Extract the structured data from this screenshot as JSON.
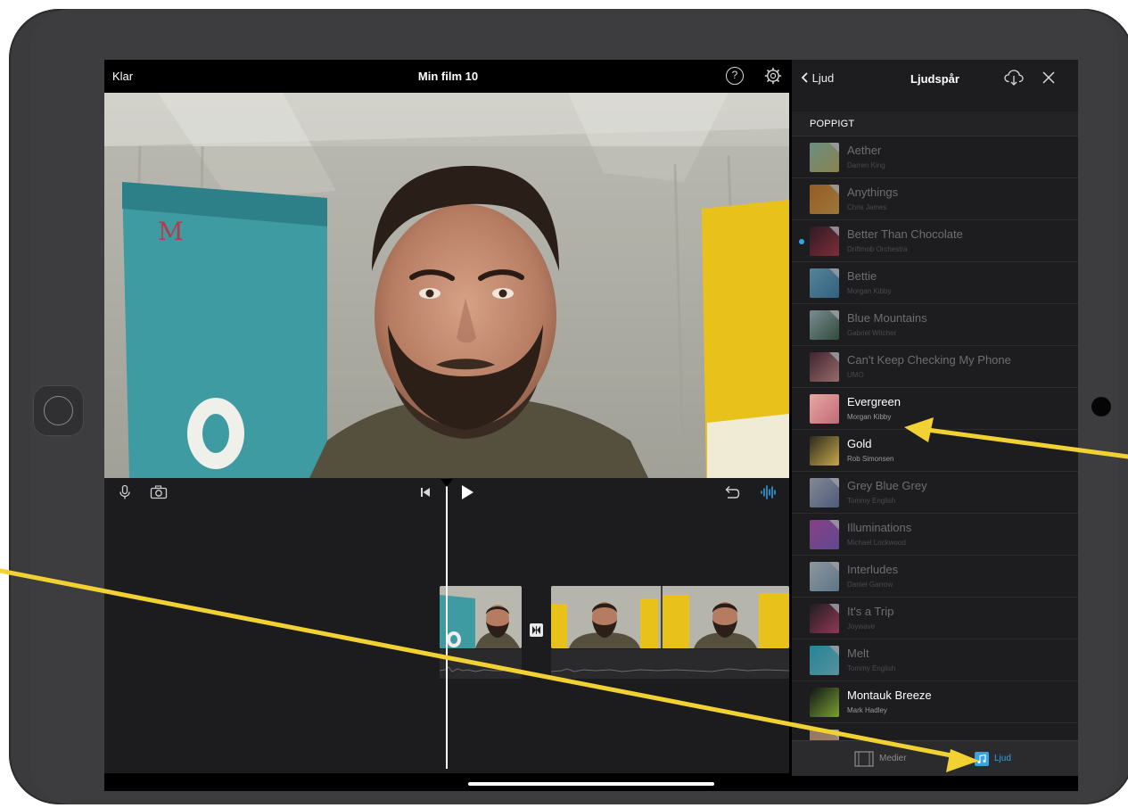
{
  "topbar": {
    "done_label": "Klar",
    "title": "Min film 10",
    "help_glyph": "?"
  },
  "panel": {
    "back_label": "Ljud",
    "title": "Ljudspår",
    "section": "POPPIGT",
    "tracks": [
      {
        "name": "Aether",
        "artist": "Darren King",
        "available": false,
        "art": [
          "#9fd8c8",
          "#d3c86a"
        ]
      },
      {
        "name": "Anythings",
        "artist": "Chris James",
        "available": false,
        "art": [
          "#e8862a",
          "#f2b34a"
        ]
      },
      {
        "name": "Better Than Chocolate",
        "artist": "Driftmob Orchestra",
        "available": false,
        "art": [
          "#3a1a2a",
          "#c0394a"
        ]
      },
      {
        "name": "Bettie",
        "artist": "Morgan Kibby",
        "available": false,
        "art": [
          "#7ac8e8",
          "#3f8fc0"
        ]
      },
      {
        "name": "Blue Mountains",
        "artist": "Gabriel Witcher",
        "available": false,
        "art": [
          "#b8d6e0",
          "#3e6a4e"
        ]
      },
      {
        "name": "Can't Keep Checking My Phone",
        "artist": "UMO",
        "available": false,
        "art": [
          "#5a2a3a",
          "#e8a0a0"
        ]
      },
      {
        "name": "Evergreen",
        "artist": "Morgan Kibby",
        "available": true,
        "art": [
          "#e8a8a0",
          "#c06a78"
        ]
      },
      {
        "name": "Gold",
        "artist": "Rob Simonsen",
        "available": true,
        "art": [
          "#2a2a1e",
          "#c8a84a"
        ]
      },
      {
        "name": "Grey Blue Grey",
        "artist": "Tommy English",
        "available": false,
        "art": [
          "#c8d0e0",
          "#6e86b8"
        ]
      },
      {
        "name": "Illuminations",
        "artist": "Michael Lockwood",
        "available": false,
        "art": [
          "#d058c8",
          "#8a68e0"
        ]
      },
      {
        "name": "Interludes",
        "artist": "Daniel Garrow",
        "available": false,
        "art": [
          "#d8e8f0",
          "#8ab0d0"
        ]
      },
      {
        "name": "It's a Trip",
        "artist": "Joywave",
        "available": false,
        "art": [
          "#202020",
          "#e04878"
        ]
      },
      {
        "name": "Melt",
        "artist": "Tommy English",
        "available": false,
        "art": [
          "#2ac8e8",
          "#80e0f0"
        ]
      },
      {
        "name": "Montauk Breeze",
        "artist": "Mark Hadley",
        "available": true,
        "art": [
          "#101418",
          "#7aa030"
        ]
      },
      {
        "name": "",
        "artist": "",
        "available": false,
        "art": [
          "#e8b090",
          "#f0d0a0"
        ]
      }
    ],
    "tabs": {
      "media_label": "Medier",
      "audio_label": "Ljud"
    }
  },
  "colors": {
    "accent": "#33a4ea",
    "annotation": "#f2d232"
  },
  "icons": [
    "help-icon",
    "settings-icon",
    "microphone-icon",
    "camera-icon",
    "skip-back-icon",
    "play-icon",
    "undo-icon",
    "waveform-icon",
    "cloud-download-icon",
    "close-icon",
    "back-chevron-icon",
    "film-icon",
    "music-note-icon"
  ]
}
